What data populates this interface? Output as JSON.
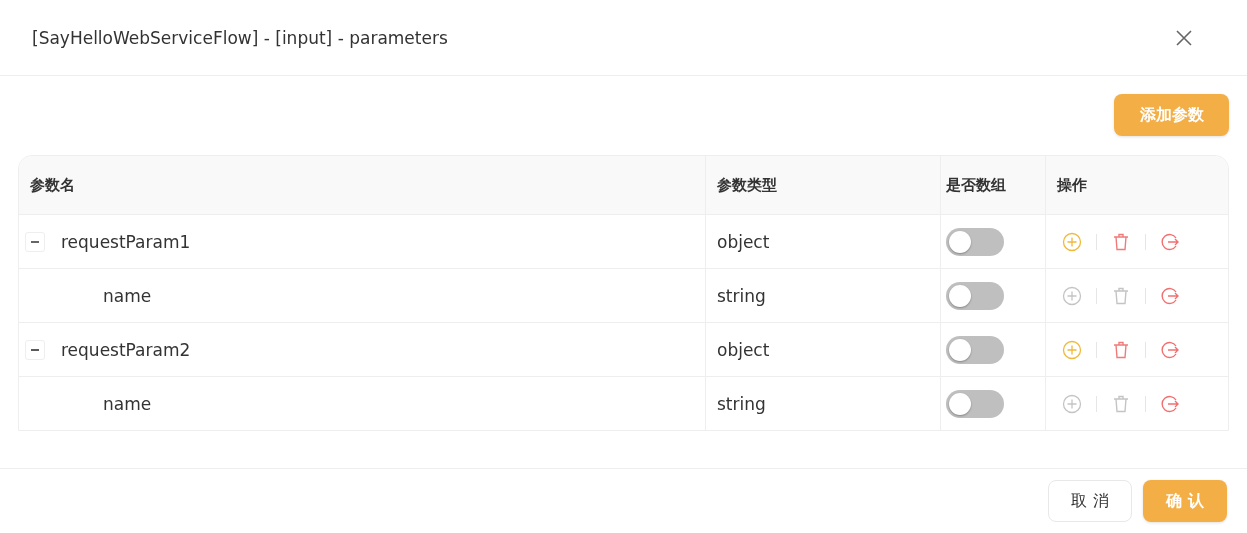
{
  "dialog": {
    "title": "[SayHelloWebServiceFlow] - [input] - parameters"
  },
  "toolbar": {
    "add_button": "添加参数"
  },
  "table": {
    "columns": [
      "参数名",
      "参数类型",
      "是否数组",
      "操作"
    ],
    "rows": [
      {
        "name": "requestParam1",
        "type": "object",
        "is_array": false,
        "expanded": true,
        "add_disabled": false,
        "delete_disabled": false,
        "children": [
          {
            "name": "name",
            "type": "string",
            "is_array": false,
            "add_disabled": true,
            "delete_disabled": true
          }
        ]
      },
      {
        "name": "requestParam2",
        "type": "object",
        "is_array": false,
        "expanded": true,
        "add_disabled": false,
        "delete_disabled": false,
        "children": [
          {
            "name": "name",
            "type": "string",
            "is_array": false,
            "add_disabled": true,
            "delete_disabled": true
          }
        ]
      }
    ]
  },
  "footer": {
    "cancel_button": "取 消",
    "confirm_button": "确 认"
  }
}
